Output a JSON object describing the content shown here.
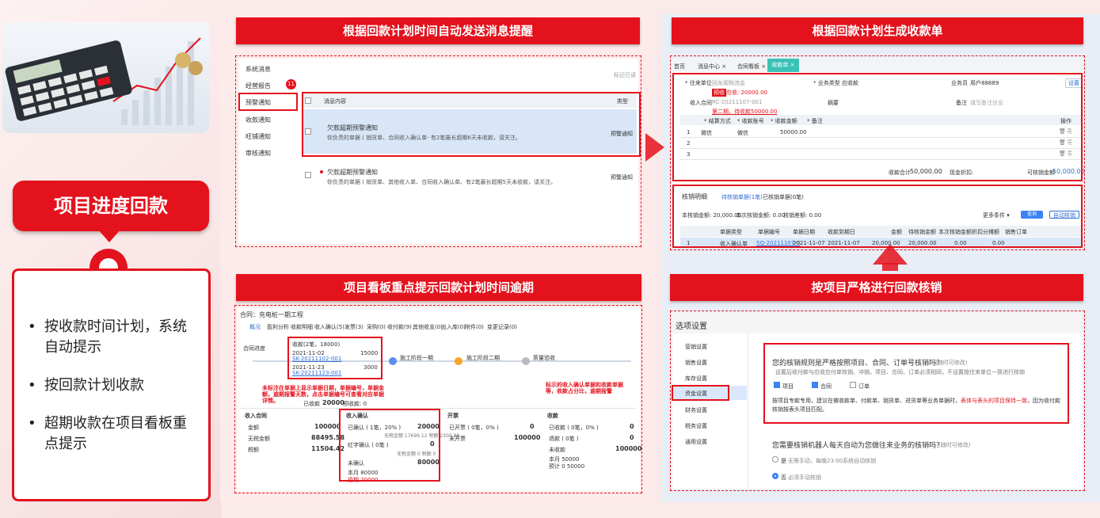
{
  "left": {
    "title": "项目进度回款",
    "bullets": [
      "按收款时间计划，系统自动提示",
      "按回款计划收款",
      "超期收款在项目看板重点提示"
    ]
  },
  "panels": {
    "p1": {
      "title": "根据回款计划时间自动发送消息提醒",
      "menu": [
        "系统消息",
        "经营报告",
        "预警通知",
        "收款通知",
        "旺铺通知",
        "审核通知"
      ],
      "badge": "11",
      "mark_read": "标记已读",
      "col_content": "消息内容",
      "col_type": "类型",
      "rows": [
        {
          "title": "欠款超期预警通知",
          "desc": "你负责的单据 ( 销货单、合同收入确认单- 有2笔最长超期6天未收款，请关注。",
          "type": "预警通知"
        },
        {
          "title": "欠款超期预警通知",
          "desc": "你负责的单据 ( 销货单、其他收入单、合同收入确认单、有2笔最长超期5天未收款，请关注。",
          "type": "预警通知"
        }
      ]
    },
    "p2": {
      "title": "根据回款计划生成收款单",
      "tabs": [
        "首页",
        "消息中心 ×",
        "合同看板 ×",
        "收款单 ×"
      ],
      "fields": {
        "unit_label": "* 往来单位",
        "unit_value": "回龙观物流会",
        "warn_tag": "预收",
        "unit_amount": "应收: 20000.00",
        "biz_label": "* 业务类型",
        "biz_value": "应收款",
        "staff_label": "业务员",
        "staff_value": "用户88889",
        "settings": "设置",
        "contract_label": "收入合同",
        "contract_value": "RC-20211107-001",
        "contract_note": "第二期，待收款50000.00",
        "summary_label": "摘要",
        "remark_label": "备注",
        "remark_ph": "填写备注信息"
      },
      "pay_cols": [
        "* 结算方式",
        "* 收款账号",
        "* 收款金额",
        "* 备注",
        "操作"
      ],
      "pay_rows": [
        {
          "n": "1",
          "method": "微信",
          "account": "微信",
          "amount": "50000.00"
        },
        {
          "n": "2",
          "method": "",
          "account": "",
          "amount": ""
        },
        {
          "n": "3",
          "method": "",
          "account": "",
          "amount": ""
        }
      ],
      "totals": {
        "recv_label": "收款合计",
        "recv": "50,000.00",
        "disc_label": "现金折扣:",
        "verify_label": "可核销金额",
        "verify": "50,000.00"
      },
      "detail": {
        "title": "核销明细",
        "tab1": "待核销单据(1笔)",
        "tab2": "已核销单据(0笔)",
        "stat1": "本核销金额: 20,000.00",
        "stat2": "本次核销金额: 0.00",
        "stat3": "核销差额: 0.00",
        "filter": "更多条件 ▾",
        "query": "查询",
        "auto": "自动核销",
        "cols": [
          "单据类型",
          "单据编号",
          "单据日期",
          "收款到期日",
          "金额",
          "待核销金额",
          "本次核销金额",
          "折扣分摊额",
          "销售订单"
        ],
        "row": [
          "1",
          "收入确认单",
          "SQ-20211107-0",
          "2021-11-07",
          "2021-11-07",
          "20,000.00",
          "20,000.00",
          "0.00",
          "0.00"
        ]
      }
    },
    "p3": {
      "title": "项目看板重点提示回款计划时间逾期",
      "contract": "合同：充电桩一期工程",
      "tabs": [
        "概况",
        "盈利分析",
        "收款明细",
        "收入确认(5)",
        "发票(3)",
        "采购(0)",
        "收付款(9)",
        "其他收支(0)",
        "出入库(0)",
        "附件(0)",
        "变更记录(0)"
      ],
      "timeline_label": "合同进度",
      "plan_box": {
        "title": "收款(2笔，18000)",
        "d1": "2021-11-02",
        "a1": "15000",
        "c1": "SK-20211102-001",
        "d2": "2021-11-23",
        "a2": "3000",
        "c2": "SK-20211123-001"
      },
      "nodes": [
        "施工阶段一期",
        "施工阶段二期",
        "质量验收"
      ],
      "note_left": "未标注在单据上显示单据日期，单据编号，单据金额，逾期报警天数，点击单据编号可查看对应单据详情。",
      "note_right": "标示的收入确认单据和收款单据等，收款占分比，逾期报警",
      "summary": {
        "received_label": "已收款",
        "received": "20000",
        "plan_label": "预收款: 0"
      },
      "cards": [
        {
          "name": "收入合同",
          "l1": "金额",
          "v1": "100000",
          "l2": "无税金额",
          "v2": "88495.58",
          "l3": "税额",
          "v3": "11504.42"
        },
        {
          "name": "收入确认",
          "l1": "已确认 ( 1笔，20% )",
          "v1": "20000",
          "sub1": "无税金额 17699.12 税额 2300.88",
          "l2": "红字确认 ( 0笔 )",
          "v2": "0",
          "sub2": "无税金额 0 税额 0",
          "l3": "未确认",
          "v3": "80000",
          "p1": "本月 80000",
          "p2": "逾期 20000"
        },
        {
          "name": "开票",
          "l1": "已开票 ( 0笔，0% )",
          "v1": "0",
          "l2": "未开票",
          "v2": "100000"
        },
        {
          "name": "收款",
          "l1": "已收款 ( 0笔，0% )",
          "v1": "0",
          "l2": "退款 ( 0笔 )",
          "v2": "0",
          "l3": "未收款",
          "v3": "100000",
          "p1": "本月 50000",
          "p2": "预计 0 50000"
        }
      ]
    },
    "p4": {
      "title": "按项目严格进行回款核销",
      "header": "选项设置",
      "menu": [
        "营销设置",
        "销售设置",
        "库存设置",
        "资金设置",
        "财务设置",
        "税务设置",
        "通用设置"
      ],
      "q1": "您的核销规则是严格按照项目、合同、订单号核销吗？",
      "q1_hint": "(随时可修改)",
      "q1_sub": "设置后收付款与应收应付单核销、冲销，项目、合同、订单必须相同，不设置按往来单位一致进行核销",
      "checks": [
        "项目",
        "合同",
        "订单"
      ],
      "q1_note_a": "按项目专款专用，建议在做收款单、付款单、销货单、进货单等业务单据时，",
      "q1_note_red": "表体与表头的项目保持一致",
      "q1_note_b": "，因为收付款核销按表头项目匹配。",
      "q2": "您需要核销机器人每天自动为您做往来业务的核销吗？",
      "q2_hint": "(随时可修改)",
      "opt_yes": "是",
      "opt_yes_sub": "无需手动，每晚23:00系统自动核销",
      "opt_no": "否",
      "opt_no_sub": "必须手动核销"
    }
  }
}
